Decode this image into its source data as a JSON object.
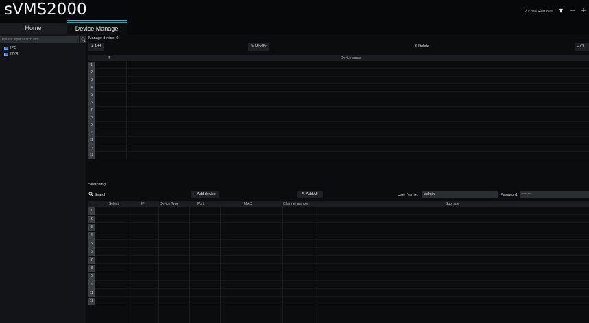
{
  "app": {
    "title": "sVMS2000",
    "sysstats": "CPU:20% RAM:86%"
  },
  "tabs": [
    {
      "label": "Home"
    },
    {
      "label": "Device Manage"
    }
  ],
  "window_controls": {
    "menu": "▾",
    "minimize": "−",
    "maximize": "+"
  },
  "sidebar": {
    "search_placeholder": "Please input search info",
    "tree": [
      {
        "label": "IPC"
      },
      {
        "label": "NVR"
      }
    ]
  },
  "manage": {
    "label": "Manage device: 0",
    "add": "+ Add",
    "modify": "✎ Modify",
    "delete": "✕ Delete",
    "right_partial": "↘ Cl",
    "columns": [
      "IP",
      "Device name"
    ],
    "row_numbers": [
      "1",
      "2",
      "3",
      "4",
      "5",
      "6",
      "7",
      "8",
      "9",
      "10",
      "11",
      "12",
      "13"
    ]
  },
  "search": {
    "status": "Searching...",
    "search_label": "Search",
    "add_device": "+ Add device",
    "add_all": "✎ Add All",
    "username_label": "User Name:",
    "username_value": "admin",
    "password_label": "Password:",
    "password_value": "••••••",
    "columns": [
      "Select",
      "IP",
      "Device Type",
      "Port",
      "MAC",
      "Channel number",
      "Sub type"
    ],
    "row_numbers": [
      "1",
      "2",
      "3",
      "4",
      "5",
      "6",
      "7",
      "8",
      "9",
      "10",
      "11",
      "12"
    ]
  }
}
